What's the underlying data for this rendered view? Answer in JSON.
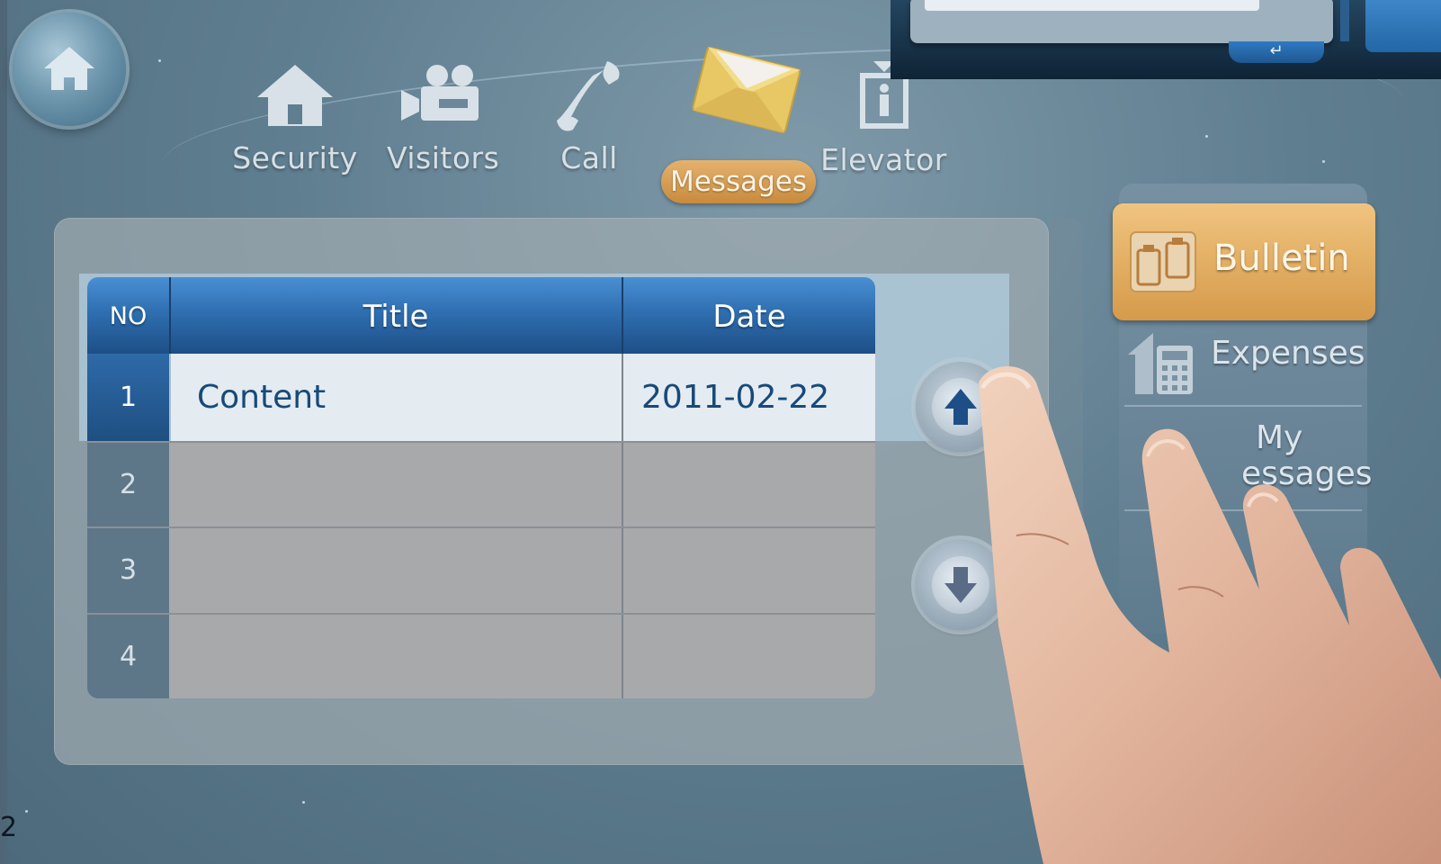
{
  "nav": {
    "items": [
      {
        "label": "Security",
        "icon": "house-icon"
      },
      {
        "label": "Visitors",
        "icon": "camera-icon"
      },
      {
        "label": "Call",
        "icon": "phone-icon"
      },
      {
        "label": "Messages",
        "icon": "envelope-icon",
        "active": true
      },
      {
        "label": "Elevator",
        "icon": "elevator-icon"
      }
    ]
  },
  "table": {
    "headers": {
      "no": "NO",
      "title": "Title",
      "date": "Date"
    },
    "rows": [
      {
        "no": "1",
        "title": "Content",
        "date": "2011-02-22",
        "selected": true
      },
      {
        "no": "2",
        "title": "",
        "date": ""
      },
      {
        "no": "3",
        "title": "",
        "date": ""
      },
      {
        "no": "4",
        "title": "",
        "date": ""
      }
    ]
  },
  "sidebar": {
    "items": [
      {
        "label": "Bulletin",
        "icon": "clipboard-icon",
        "active": true
      },
      {
        "label": "Expenses",
        "icon": "calculator-icon"
      },
      {
        "label_line1": "My",
        "label_line2": "essages"
      }
    ]
  },
  "inset": {
    "enter_glyph": "↵"
  },
  "corner_text": "2",
  "colors": {
    "accent_active": "#d69a4a",
    "header_blue": "#2f6fb1",
    "text_blue": "#164a7a"
  }
}
